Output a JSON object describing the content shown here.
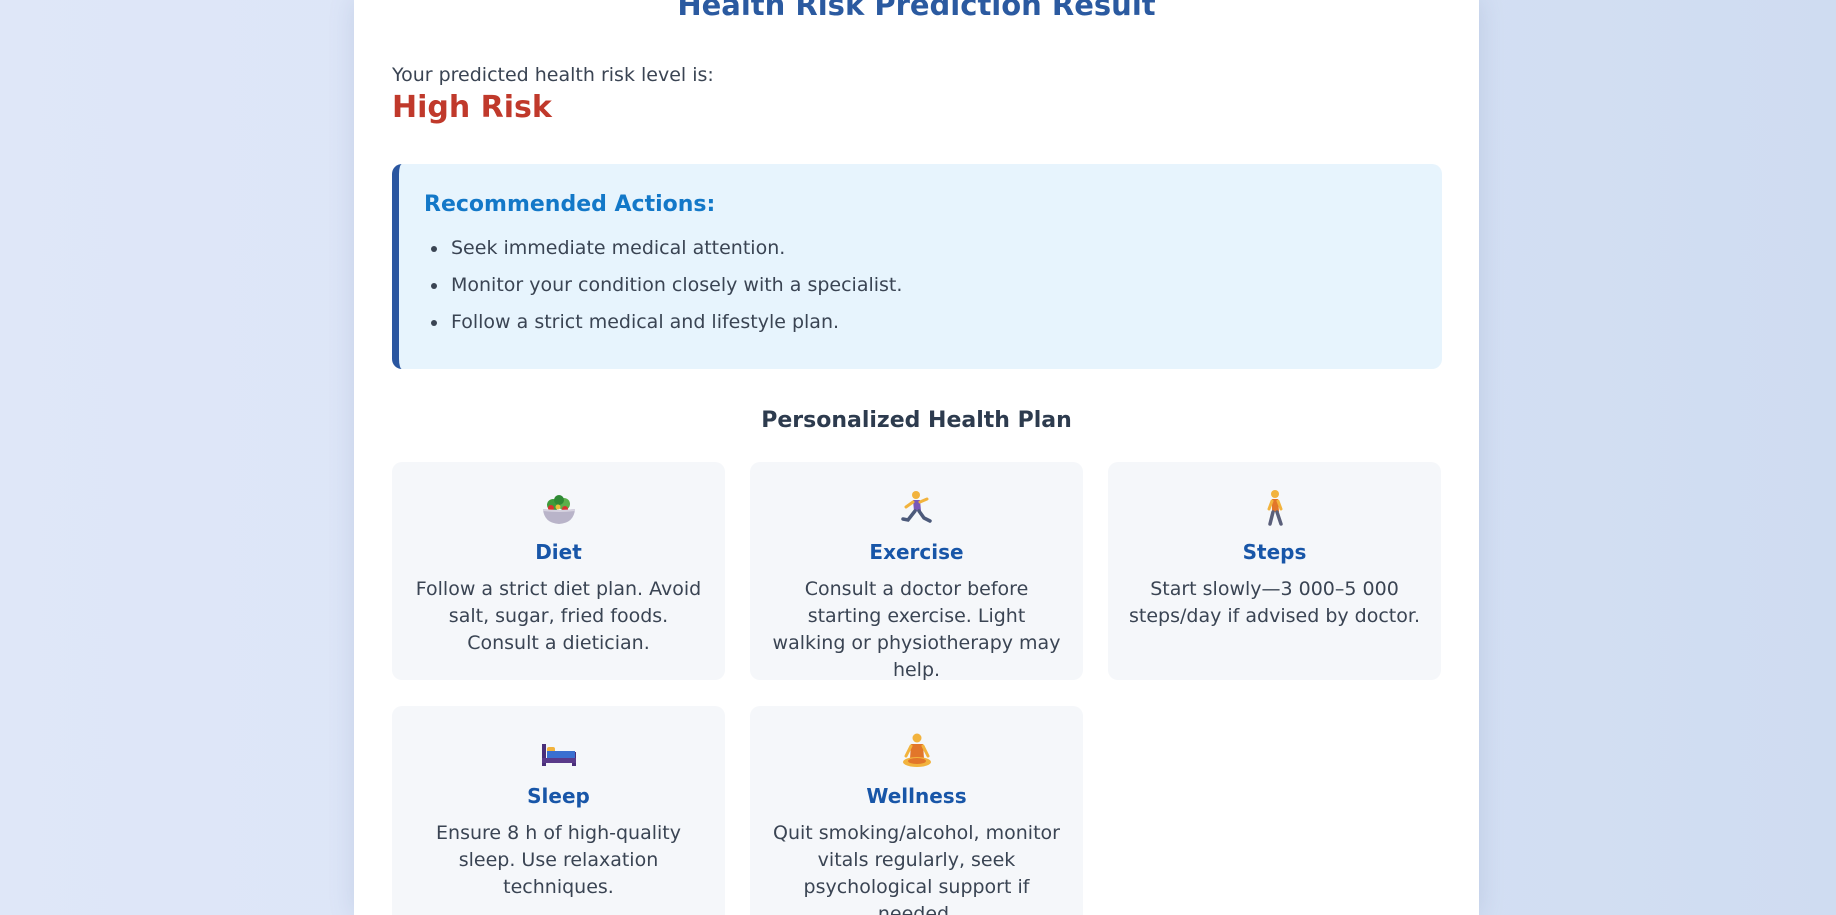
{
  "header": {
    "title": "Health Risk Prediction Result"
  },
  "result": {
    "label": "Your predicted health risk level is:",
    "level": "High Risk",
    "level_color": "#c0392b"
  },
  "recommendations": {
    "title": "Recommended Actions:",
    "items": [
      "Seek immediate medical attention.",
      "Monitor your condition closely with a specialist.",
      "Follow a strict medical and lifestyle plan."
    ]
  },
  "plan": {
    "title": "Personalized Health Plan",
    "cards": [
      {
        "icon": "salad-bowl-icon",
        "name": "Diet",
        "text": "Follow a strict diet plan. Avoid salt, sugar, fried foods. Consult a dietician."
      },
      {
        "icon": "running-person-icon",
        "name": "Exercise",
        "text": "Consult a doctor before starting exercise. Light walking or physiotherapy may help."
      },
      {
        "icon": "walking-person-icon",
        "name": "Steps",
        "text": "Start slowly—3 000–5 000 steps/day if advised by doctor."
      },
      {
        "icon": "bed-icon",
        "name": "Sleep",
        "text": "Ensure 8 h of high-quality sleep. Use relaxation techniques."
      },
      {
        "icon": "meditation-person-icon",
        "name": "Wellness",
        "text": "Quit smoking/alcohol, monitor vitals regularly, seek psychological support if needed."
      }
    ]
  },
  "colors": {
    "title": "#2b5aa0",
    "accent": "#1378c8",
    "card_title": "#1856a8",
    "danger": "#c0392b"
  }
}
